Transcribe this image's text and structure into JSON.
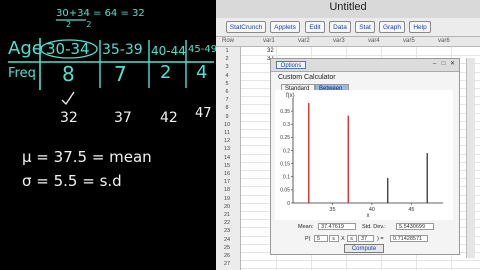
{
  "board": {
    "computation": "30+34 = 64 = 32",
    "computation_bottom": "2      2",
    "row_age_label": "Age",
    "row_freq_label": "Freq",
    "intervals": [
      "30-34",
      "35-39",
      "40-44",
      "45-49"
    ],
    "frequencies": [
      "8",
      "7",
      "2",
      "4"
    ],
    "midpoints": [
      "32",
      "37",
      "42",
      "47"
    ],
    "mean_line": "μ = 37.5 = mean",
    "sd_line": "σ = 5.5 = s.d"
  },
  "app": {
    "title": "Untitled",
    "toolbar": [
      "StatCrunch",
      "Applets",
      "Edit",
      "Data",
      "Stat",
      "Graph",
      "Help"
    ],
    "columns": [
      "Row",
      "var1",
      "var2",
      "var3",
      "var4",
      "var5",
      "var6"
    ],
    "rows": [
      "1",
      "2",
      "3",
      "4",
      "5",
      "6",
      "7",
      "8",
      "9",
      "10",
      "11",
      "12",
      "13",
      "14",
      "15",
      "16",
      "17",
      "18",
      "19",
      "20",
      "21",
      "22",
      "23",
      "24",
      "25",
      "26",
      "27"
    ],
    "cell_values": [
      "32",
      "37"
    ],
    "calculator": {
      "options_label": "Options",
      "title": "Custom Calculator",
      "tabs": [
        "Standard",
        "Between"
      ],
      "y_axis_label": "f(x)",
      "x_axis_label": "x",
      "mean_label": "Mean:",
      "mean_value": "37.47619",
      "sd_label": "Std. Dev.:",
      "sd_value": "5.5430699",
      "prob_prefix": "P(",
      "prob_op1": "≤",
      "prob_lower": "5",
      "prob_mid": "X",
      "prob_op2": "≤",
      "prob_upper": "37",
      "prob_suffix": ") =",
      "prob_value": "0.71428571",
      "compute_label": "Compute"
    }
  },
  "chart_data": {
    "type": "bar",
    "x": [
      32,
      37,
      42,
      47
    ],
    "values": [
      0.381,
      0.333,
      0.095,
      0.19
    ],
    "ylabel": "f(x)",
    "xlabel": "x",
    "xticks": [
      "35",
      "40",
      "45"
    ],
    "yticks": [
      "0",
      "0.05",
      "0.1",
      "0.15",
      "0.2",
      "0.25",
      "0.3",
      "0.35"
    ],
    "ylim": [
      0,
      0.4
    ],
    "xlim": [
      30,
      49
    ],
    "colors": {
      "shaded": "#cc2222",
      "unshaded": "#333333"
    }
  },
  "colors": {
    "ink": "#4fe0d0",
    "ink_white": "#f2f2f2",
    "toolbar_text": "#1b3f9c",
    "tab_active": "#9bb7e8"
  }
}
